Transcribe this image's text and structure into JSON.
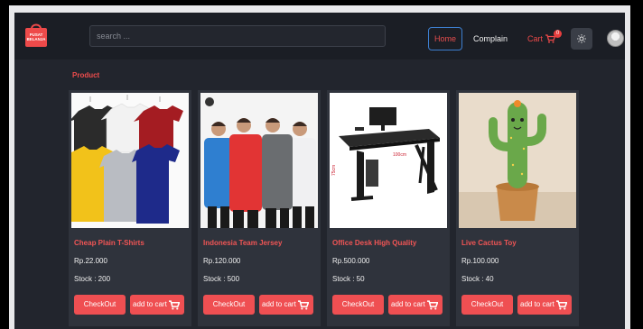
{
  "brand": {
    "logo_icon": "shopping-bag-icon",
    "logo_text": "PUSAT BELANJA",
    "accent": "#e84e4e"
  },
  "search": {
    "placeholder": "search ..."
  },
  "nav": {
    "home_label": "Home",
    "complain_label": "Complain",
    "cart_label": "Cart",
    "cart_count": "0",
    "theme_icon": "sun-icon",
    "avatar_icon": "user-avatar"
  },
  "section": {
    "title": "Product"
  },
  "products": [
    {
      "name": "Cheap Plain T-Shirts",
      "price": "Rp.22.000",
      "stock": "Stock : 200",
      "image_icon": "tshirts-image",
      "checkout_label": "CheckOut",
      "cart_label": "add to cart"
    },
    {
      "name": "Indonesia Team Jersey",
      "price": "Rp.120.000",
      "stock": "Stock : 500",
      "image_icon": "jersey-image",
      "checkout_label": "CheckOut",
      "cart_label": "add to cart"
    },
    {
      "name": "Office Desk High Quality",
      "price": "Rp.500.000",
      "stock": "Stock : 50",
      "image_icon": "desk-image",
      "checkout_label": "CheckOut",
      "cart_label": "add to cart"
    },
    {
      "name": "Live Cactus Toy",
      "price": "Rp.100.000",
      "stock": "Stock : 40",
      "image_icon": "cactus-toy-image",
      "checkout_label": "CheckOut",
      "cart_label": "add to cart"
    }
  ]
}
